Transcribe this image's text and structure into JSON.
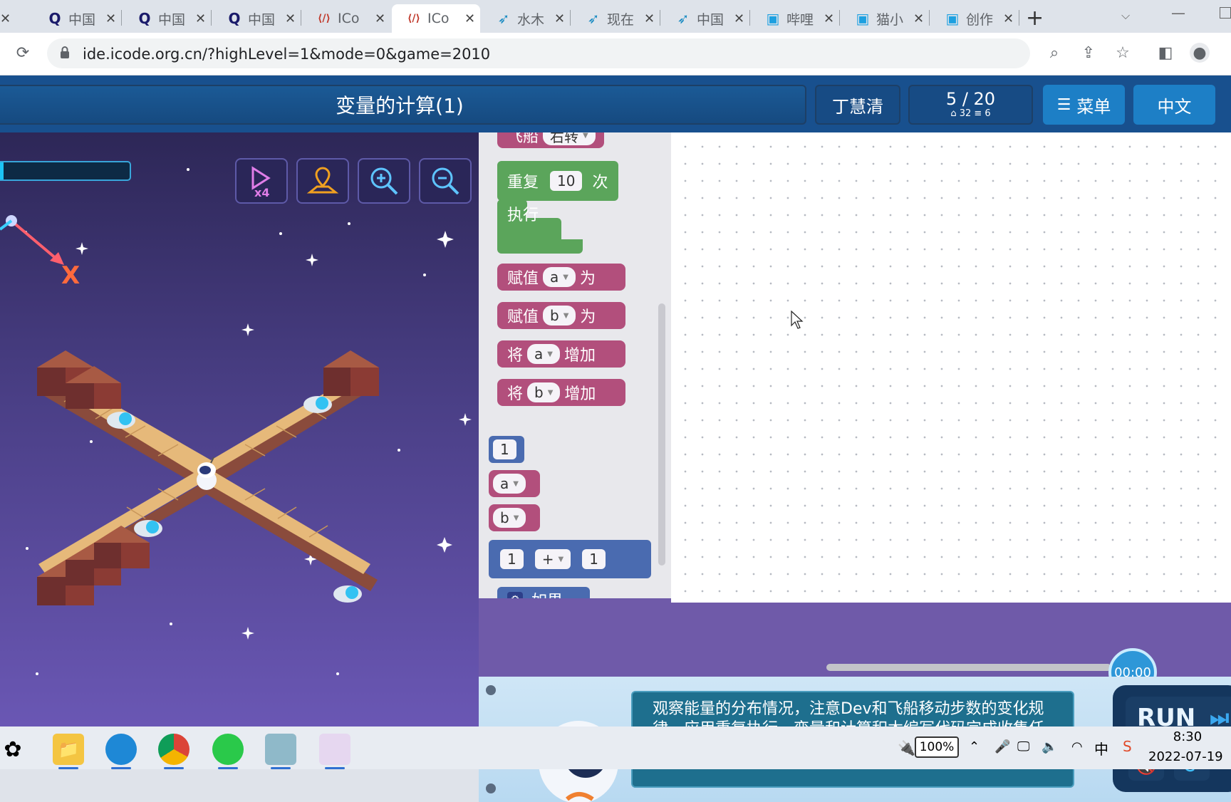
{
  "browser": {
    "tabs": [
      {
        "title": "中国",
        "icon": "q-icon"
      },
      {
        "title": "中国",
        "icon": "q-icon"
      },
      {
        "title": "中国",
        "icon": "q-icon"
      },
      {
        "title": "ICo",
        "icon": "code-icon"
      },
      {
        "title": "ICo",
        "icon": "code-icon",
        "active": true
      },
      {
        "title": "水木",
        "icon": "bird-icon"
      },
      {
        "title": "现在",
        "icon": "bird-icon"
      },
      {
        "title": "中国",
        "icon": "bird-icon"
      },
      {
        "title": "哔哩",
        "icon": "tv-icon"
      },
      {
        "title": "猫小",
        "icon": "tv-icon"
      },
      {
        "title": "创作",
        "icon": "tv-icon"
      }
    ],
    "url": "ide.icode.org.cn/?highLevel=1&mode=0&game=2010"
  },
  "app": {
    "level_title": "变量的计算(1)",
    "user_name": "丁慧清",
    "level_progress": "5 / 20",
    "level_stats": "⌂ 32   ≡ 6",
    "menu_label": "菜单",
    "language_label": "中文",
    "energy_progress": 0.05,
    "direction_marker": "X"
  },
  "toolbox": {
    "partial_block": {
      "text": "飞船",
      "option": "右转"
    },
    "repeat": {
      "label": "重复",
      "count": "10",
      "unit": "次",
      "do_label": "执行"
    },
    "assign_a": {
      "label": "赋值",
      "var": "a",
      "suffix": "为"
    },
    "assign_b": {
      "label": "赋值",
      "var": "b",
      "suffix": "为"
    },
    "increase_a": {
      "label": "将",
      "var": "a",
      "suffix": "增加"
    },
    "increase_b": {
      "label": "将",
      "var": "b",
      "suffix": "增加"
    },
    "number_block": "1",
    "var_a": "a",
    "var_b": "b",
    "math": {
      "left": "1",
      "op": "+",
      "right": "1"
    },
    "if_block": "如果"
  },
  "timer": "00:00",
  "hint": "观察能量的分布情况，注意Dev和飞船移动步数的变化规律，应用重复执行、变量和计算积木编写代码完成收集任务。",
  "run_label": "RUN",
  "taskbar": {
    "battery": "100%",
    "time": "8:30",
    "date": "2022-07-19",
    "ime": "中"
  },
  "colors": {
    "topbar": "#18508e",
    "accent": "#1d7fc6",
    "pink_block": "#b24f7c",
    "green_block": "#5ba55b"
  }
}
